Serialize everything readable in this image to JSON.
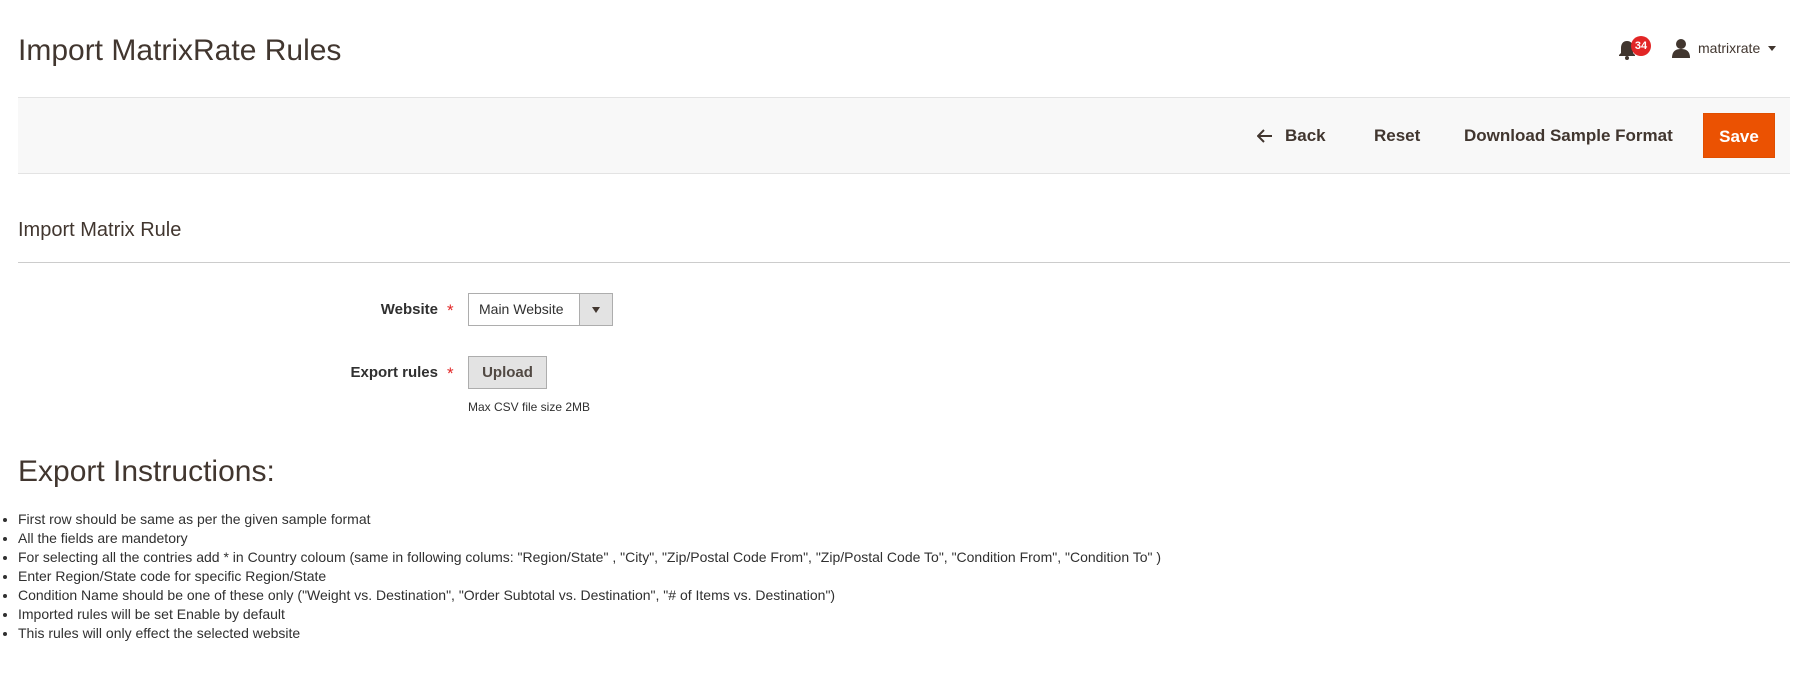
{
  "header": {
    "page_title": "Import MatrixRate Rules",
    "notifications_count": "34",
    "user_name": "matrixrate"
  },
  "actions": {
    "back_label": "Back",
    "reset_label": "Reset",
    "download_label": "Download Sample Format",
    "save_label": "Save",
    "save_color": "#eb5202"
  },
  "form": {
    "section_title": "Import Matrix Rule",
    "website_label": "Website",
    "website_value": "Main Website",
    "export_label": "Export rules",
    "upload_label": "Upload",
    "upload_note": "Max CSV file size 2MB",
    "required_marker": "*"
  },
  "instructions": {
    "title": "Export Instructions:",
    "items": [
      "First row should be same as per the given sample format",
      "All the fields are mandetory",
      "For selecting all the contries add * in Country coloum (same in following colums: \"Region/State\" , \"City\", \"Zip/Postal Code From\", \"Zip/Postal Code To\", \"Condition From\", \"Condition To\" )",
      "Enter Region/State code for specific Region/State",
      "Condition Name should be one of these only (\"Weight vs. Destination\", \"Order Subtotal vs. Destination\", \"# of Items vs. Destination\")",
      "Imported rules will be set Enable by default",
      "This rules will only effect the selected website"
    ]
  },
  "icons": {
    "notifications": "bell-icon",
    "user": "user-icon",
    "back": "arrow-left-icon",
    "select": "chevron-down-icon"
  }
}
